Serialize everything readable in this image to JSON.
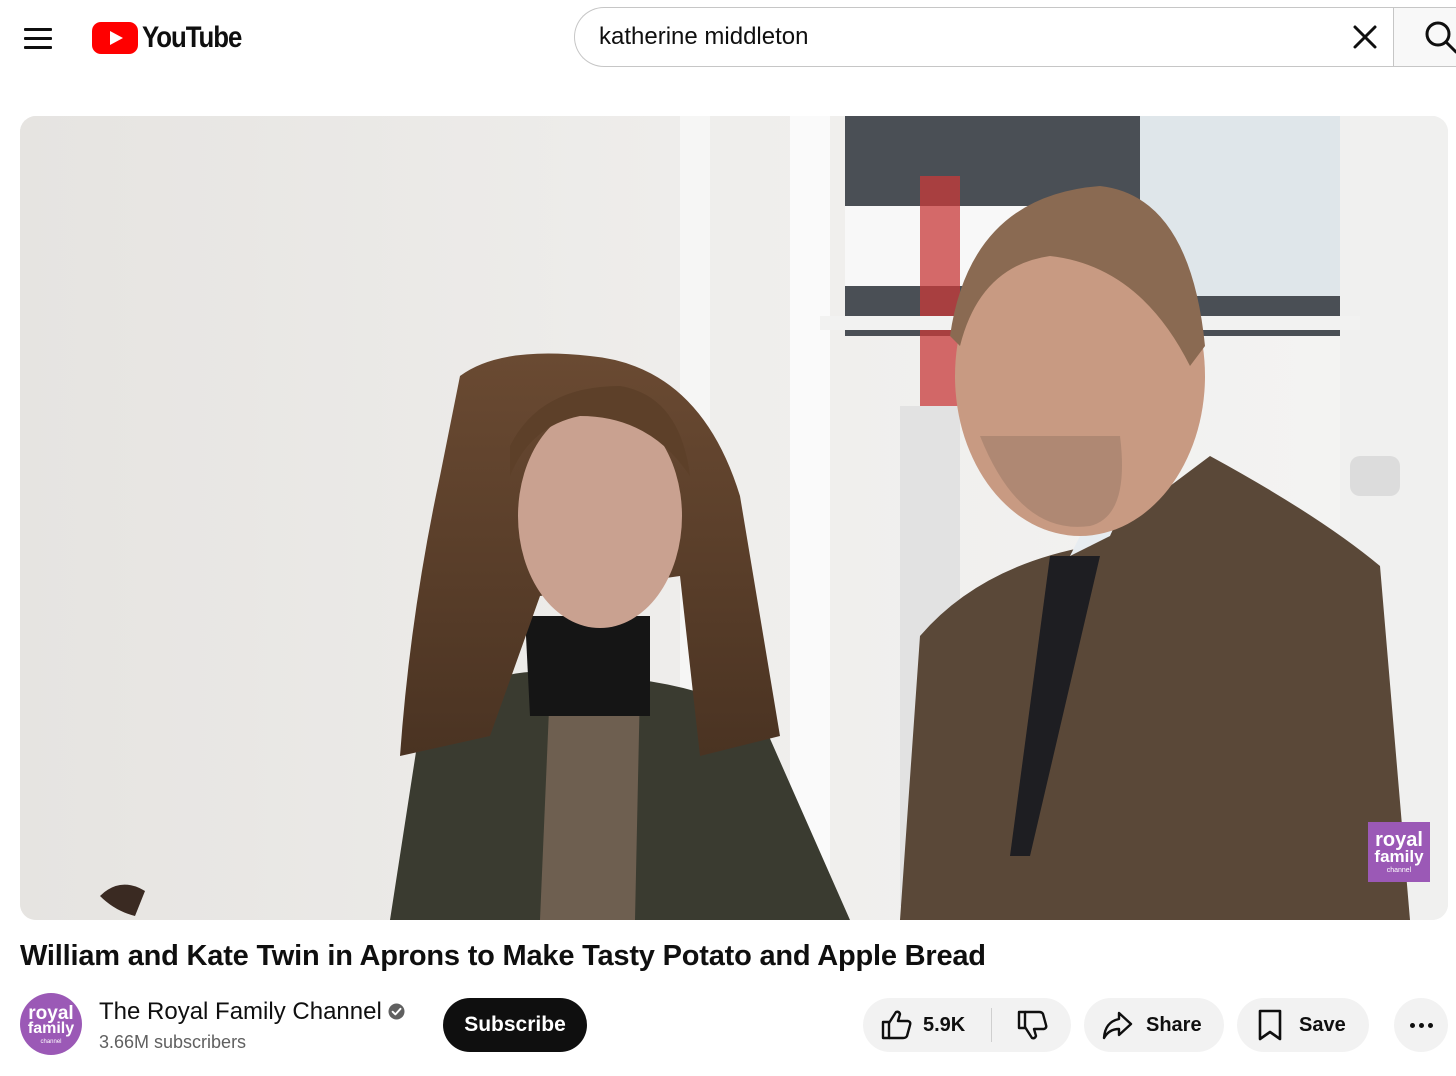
{
  "header": {
    "logo_text": "YouTube",
    "search": {
      "value": "katherine middleton"
    }
  },
  "video": {
    "title": "William and Kate Twin in Aprons to Make Tasty Potato and Apple Bread",
    "watermark": {
      "line1": "royal",
      "line2": "family",
      "line3": "channel"
    }
  },
  "channel": {
    "name": "The Royal Family Channel",
    "subscribers": "3.66M subscribers",
    "avatar": {
      "line1": "royal",
      "line2": "family",
      "line3": "channel"
    },
    "subscribe_label": "Subscribe"
  },
  "actions": {
    "like_count": "5.9K",
    "share_label": "Share",
    "save_label": "Save"
  },
  "colors": {
    "brand_red": "#ff0000",
    "channel_purple": "#9b59b6",
    "subscribe_bg": "#0f0f0f",
    "pill_bg": "#f2f2f2"
  },
  "icons": [
    "menu-icon",
    "youtube-logo-icon",
    "clear-icon",
    "search-icon",
    "verified-icon",
    "thumbs-up-icon",
    "thumbs-down-icon",
    "share-icon",
    "bookmark-icon",
    "more-icon"
  ]
}
